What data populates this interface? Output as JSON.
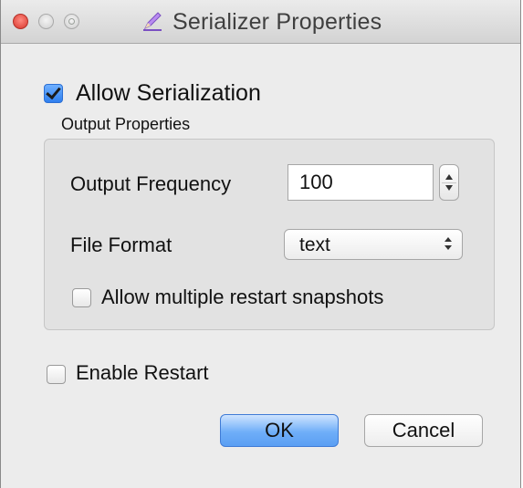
{
  "window": {
    "title": "Serializer Properties",
    "icons": {
      "close": "close-dot",
      "minimize": "minimize-dot",
      "maximize": "zoom-dot",
      "app": "pencil-icon"
    }
  },
  "allow_serialization": {
    "label": "Allow Serialization",
    "checked": true
  },
  "output_properties": {
    "group_label": "Output Properties",
    "output_frequency": {
      "label": "Output Frequency",
      "value": "100"
    },
    "file_format": {
      "label": "File Format",
      "selected": "text"
    },
    "multiple_snapshots": {
      "label": "Allow multiple restart snapshots",
      "checked": false
    }
  },
  "enable_restart": {
    "label": "Enable Restart",
    "checked": false
  },
  "buttons": {
    "ok": "OK",
    "cancel": "Cancel"
  },
  "colors": {
    "accent": "#2f7fef",
    "close": "#d8362c"
  }
}
